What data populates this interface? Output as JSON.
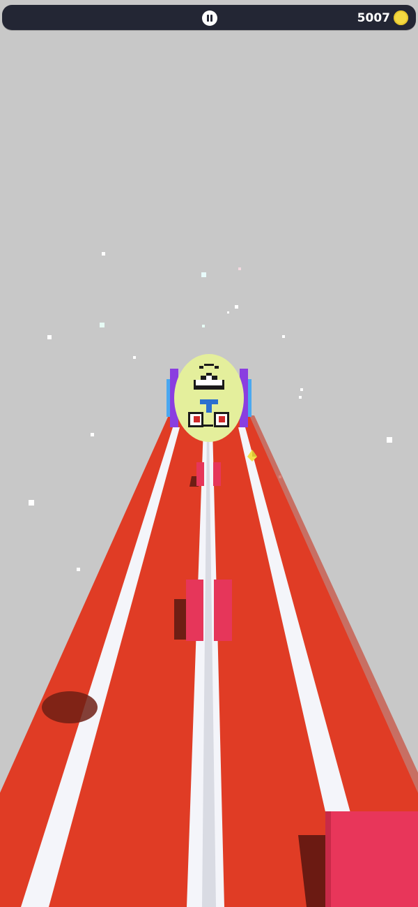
{
  "hud": {
    "coins": "5007",
    "pause_icon": "pause-icon",
    "coin_icon": "coin-icon"
  },
  "game": {
    "scene": "endless-runner-track",
    "colors": {
      "sky": "#c8c8c8",
      "track": "#e03c25",
      "lane_stripe": "#f4f5fa",
      "obstacle": "#e6365a",
      "ball": "#e4ef9c",
      "ball_band": "#8a3ee0",
      "ball_band_outer": "#4aa8f0",
      "hud_bg": "#232634",
      "coin": "#f3d942",
      "gem": "#f2e04c"
    }
  }
}
